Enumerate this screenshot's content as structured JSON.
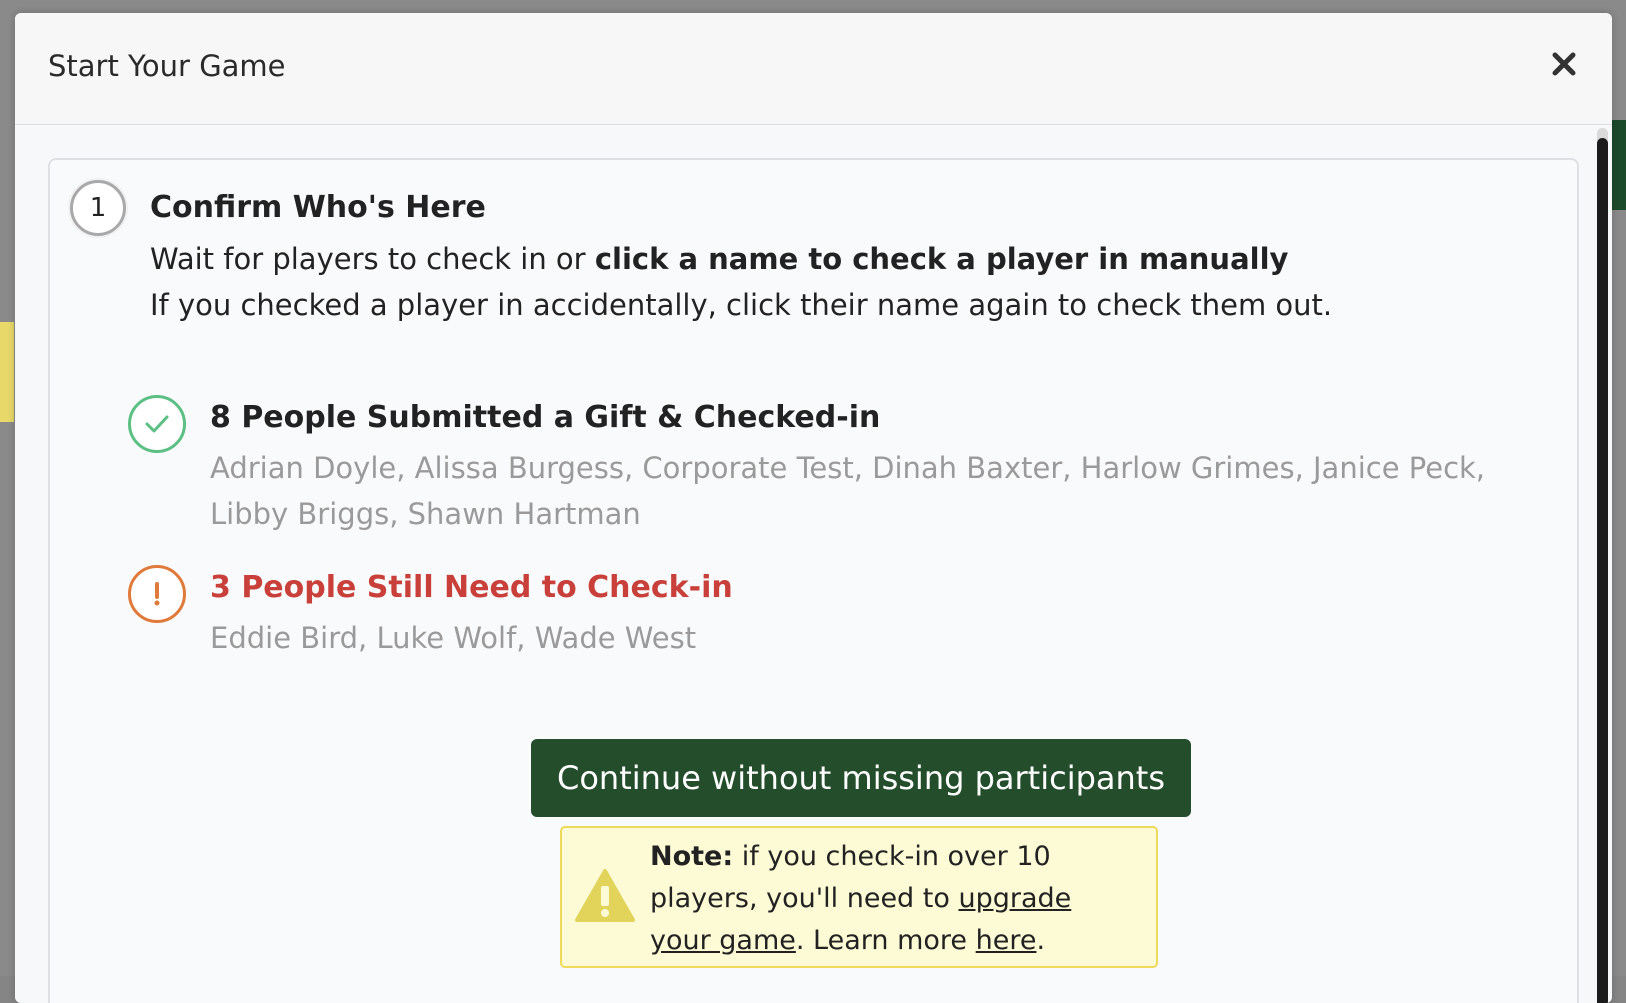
{
  "modal": {
    "title": "Start Your Game",
    "close_icon": "close-icon"
  },
  "step": {
    "number": "1",
    "title": "Confirm Who's Here",
    "instruction_plain": "Wait for players to check in or ",
    "instruction_bold": "click a name to check a player in manually",
    "instruction_2": "If you checked a player in accidentally, click their name again to check them out."
  },
  "checked_in": {
    "icon": "check-icon",
    "title": "8 People Submitted a Gift & Checked-in",
    "names_text": "Adrian Doyle, Alissa Burgess, Corporate Test, Dinah Baxter, Harlow Grimes, Janice Peck, Libby Briggs, Shawn Hartman",
    "color": "#5cbf83"
  },
  "pending": {
    "icon": "exclamation-icon",
    "title": "3 People Still Need to Check-in",
    "names_text": "Eddie Bird, Luke Wolf, Wade West",
    "color": "#c9403a"
  },
  "continue_button": {
    "label": "Continue without missing participants",
    "color": "#244d2c"
  },
  "note": {
    "icon": "warning-icon",
    "bold": "Note:",
    "text1": " if you check-in over 10 players, you'll need to ",
    "link1": "upgrade your game",
    "text2": ". Learn more ",
    "link2": "here",
    "text3": "."
  }
}
